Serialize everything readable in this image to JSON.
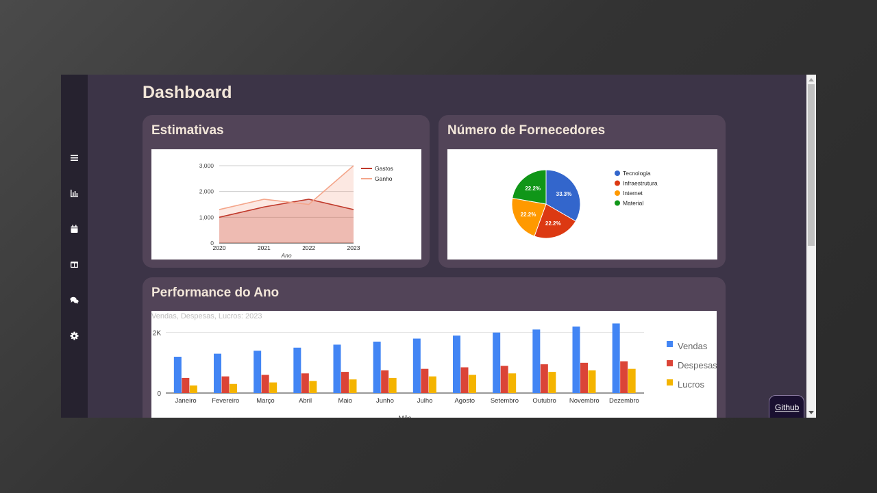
{
  "page_title": "Dashboard",
  "sidebar": {
    "items": [
      {
        "icon": "menu-icon"
      },
      {
        "icon": "bar-chart-icon"
      },
      {
        "icon": "calendar-icon"
      },
      {
        "icon": "table-icon"
      },
      {
        "icon": "comments-icon"
      },
      {
        "icon": "gear-icon"
      }
    ]
  },
  "cards": {
    "estimativas": {
      "title": "Estimativas"
    },
    "fornecedores": {
      "title": "Número de Fornecedores"
    },
    "performance": {
      "title": "Performance do Ano"
    }
  },
  "github": {
    "label": "Github"
  },
  "colors": {
    "window_bg": "#3c3447",
    "sidebar_bg": "#26222f",
    "card_bg": "#524458",
    "title_text": "#f2e6d9"
  },
  "chart_data": [
    {
      "type": "area",
      "x": [
        "2020",
        "2021",
        "2022",
        "2023"
      ],
      "xlabel": "Ano",
      "ylim": [
        0,
        3000
      ],
      "yticks": [
        "0",
        "1,000",
        "2,000",
        "3,000"
      ],
      "legend_position": "right",
      "series": [
        {
          "name": "Gastos",
          "values": [
            1000,
            1400,
            1700,
            1300
          ],
          "color": "#c0392b"
        },
        {
          "name": "Ganho",
          "values": [
            1300,
            1700,
            1500,
            3000
          ],
          "color": "#f4a58a"
        }
      ]
    },
    {
      "type": "pie",
      "legend_position": "right",
      "slices": [
        {
          "label": "Tecnologia",
          "value": 33.3,
          "text": "33.3%",
          "color": "#3366cc"
        },
        {
          "label": "Infraestrutura",
          "value": 22.2,
          "text": "22.2%",
          "color": "#dc3912"
        },
        {
          "label": "Internet",
          "value": 22.2,
          "text": "22.2%",
          "color": "#ff9900"
        },
        {
          "label": "Material",
          "value": 22.2,
          "text": "22.2%",
          "color": "#109618"
        }
      ]
    },
    {
      "type": "bar",
      "title": "Vendas, Despesas, Lucros: 2023",
      "xlabel": "Mês",
      "ylim": [
        0,
        2400
      ],
      "yticks": [
        "0",
        "2K"
      ],
      "legend_position": "right",
      "categories": [
        "Janeiro",
        "Fevereiro",
        "Março",
        "Abril",
        "Maio",
        "Junho",
        "Julho",
        "Agosto",
        "Setembro",
        "Outubro",
        "Novembro",
        "Dezembro"
      ],
      "series": [
        {
          "name": "Vendas",
          "color": "#4285f4",
          "values": [
            1200,
            1300,
            1400,
            1500,
            1600,
            1700,
            1800,
            1900,
            2000,
            2100,
            2200,
            2300
          ]
        },
        {
          "name": "Despesas",
          "color": "#db4437",
          "values": [
            500,
            550,
            600,
            650,
            700,
            750,
            800,
            850,
            900,
            950,
            1000,
            1050
          ]
        },
        {
          "name": "Lucros",
          "color": "#f4b400",
          "values": [
            250,
            300,
            350,
            400,
            450,
            500,
            550,
            600,
            650,
            700,
            750,
            800
          ]
        }
      ]
    }
  ]
}
